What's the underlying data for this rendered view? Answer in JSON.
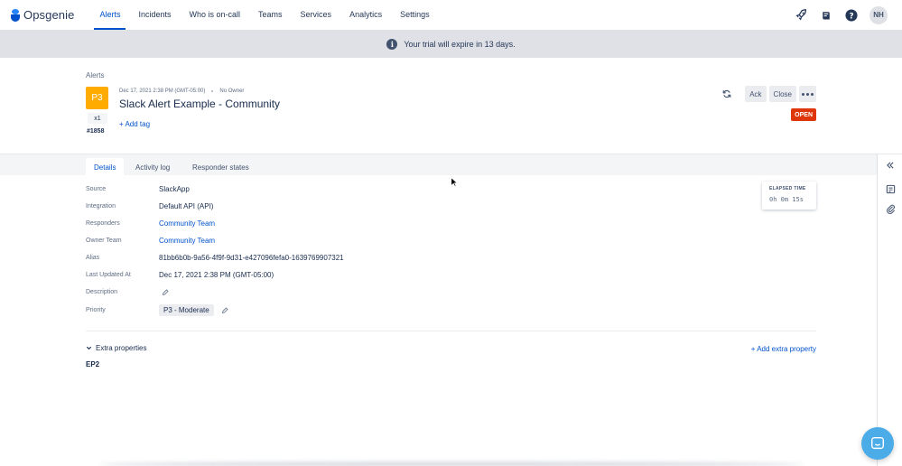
{
  "app": {
    "name": "Opsgenie"
  },
  "nav": {
    "items": [
      {
        "label": "Alerts",
        "active": true
      },
      {
        "label": "Incidents",
        "active": false
      },
      {
        "label": "Who is on-call",
        "active": false
      },
      {
        "label": "Teams",
        "active": false
      },
      {
        "label": "Services",
        "active": false
      },
      {
        "label": "Analytics",
        "active": false
      },
      {
        "label": "Settings",
        "active": false
      }
    ],
    "icons": [
      "rocket-icon",
      "book-icon",
      "help-icon"
    ],
    "avatar_initials": "NH"
  },
  "banner": {
    "text": "Your trial will expire in 13 days.",
    "icon": "info-icon"
  },
  "breadcrumb": "Alerts",
  "alert": {
    "priority": "P3",
    "count": "x1",
    "tiny_id": "#1858",
    "created": "Dec 17, 2021 2:38 PM (GMT-05:00)",
    "owner": "No Owner",
    "title": "Slack Alert Example - Community",
    "add_tag": "+ Add tag",
    "status": "OPEN",
    "status_color": "#de350b",
    "priority_color": "#ffab00"
  },
  "actions": {
    "ack": "Ack",
    "close": "Close"
  },
  "tabs": [
    {
      "label": "Details",
      "active": true
    },
    {
      "label": "Activity log",
      "active": false
    },
    {
      "label": "Responder states",
      "active": false
    }
  ],
  "details": [
    {
      "label": "Source",
      "value": "SlackApp"
    },
    {
      "label": "Integration",
      "value": "Default API (API)"
    },
    {
      "label": "Responders",
      "value": "Community Team"
    },
    {
      "label": "Owner Team",
      "value": "Community Team"
    },
    {
      "label": "Alias",
      "value": "81bb6b0b-9a56-4f9f-9d31-e427096fefa0-1639769907321"
    },
    {
      "label": "Last Updated At",
      "value": "Dec 17, 2021 2:38 PM (GMT-05:00)"
    },
    {
      "label": "Description",
      "value": ""
    },
    {
      "label": "Priority",
      "value": "P3 - Moderate"
    }
  ],
  "elapsed": {
    "label": "ELAPSED TIME",
    "value": "0h 0m 15s"
  },
  "extra": {
    "toggle_label": "Extra properties",
    "add_label": "+ Add extra property",
    "items": [
      "EP2"
    ]
  }
}
